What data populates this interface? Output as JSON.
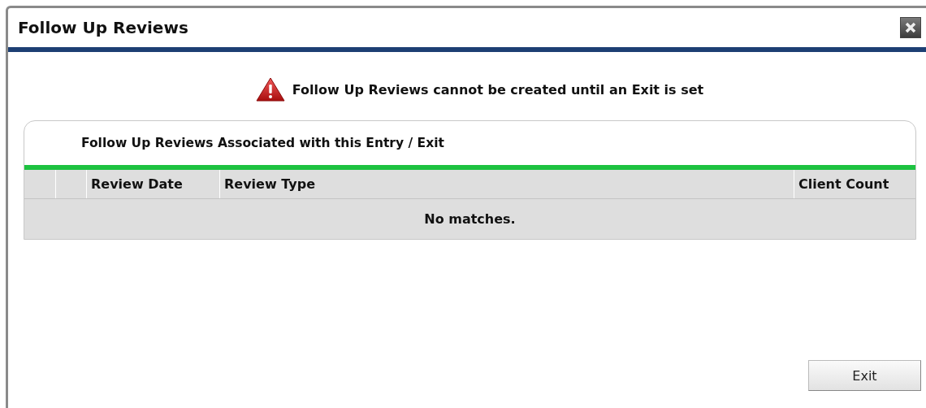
{
  "window": {
    "title": "Follow Up Reviews"
  },
  "warning": "Follow Up Reviews cannot be created until an Exit is set",
  "panel": {
    "title": "Follow Up Reviews Associated with this Entry / Exit",
    "columns": [
      "",
      "",
      "Review Date",
      "Review Type",
      "Client Count"
    ],
    "empty_message": "No matches."
  },
  "buttons": [
    "Exit"
  ]
}
